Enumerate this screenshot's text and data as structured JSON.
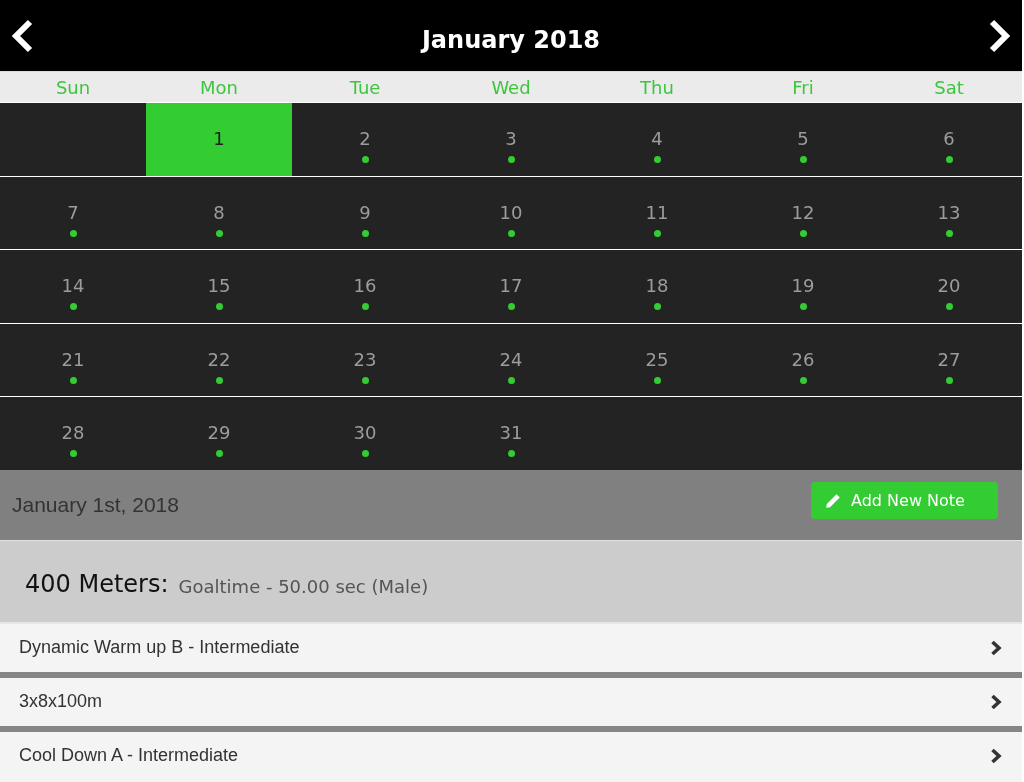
{
  "header": {
    "title": "January 2018"
  },
  "weekdays": [
    "Sun",
    "Mon",
    "Tue",
    "Wed",
    "Thu",
    "Fri",
    "Sat"
  ],
  "weeks": [
    {
      "days": [
        {
          "kind": "empty"
        },
        {
          "kind": "day",
          "label": "1",
          "selected": true,
          "has_event": false
        },
        {
          "kind": "day",
          "label": "2",
          "selected": false,
          "has_event": true
        },
        {
          "kind": "day",
          "label": "3",
          "selected": false,
          "has_event": true
        },
        {
          "kind": "day",
          "label": "4",
          "selected": false,
          "has_event": true
        },
        {
          "kind": "day",
          "label": "5",
          "selected": false,
          "has_event": true
        },
        {
          "kind": "day",
          "label": "6",
          "selected": false,
          "has_event": true
        }
      ]
    },
    {
      "days": [
        {
          "kind": "day",
          "label": "7",
          "selected": false,
          "has_event": true
        },
        {
          "kind": "day",
          "label": "8",
          "selected": false,
          "has_event": true
        },
        {
          "kind": "day",
          "label": "9",
          "selected": false,
          "has_event": true
        },
        {
          "kind": "day",
          "label": "10",
          "selected": false,
          "has_event": true
        },
        {
          "kind": "day",
          "label": "11",
          "selected": false,
          "has_event": true
        },
        {
          "kind": "day",
          "label": "12",
          "selected": false,
          "has_event": true
        },
        {
          "kind": "day",
          "label": "13",
          "selected": false,
          "has_event": true
        }
      ]
    },
    {
      "days": [
        {
          "kind": "day",
          "label": "14",
          "selected": false,
          "has_event": true
        },
        {
          "kind": "day",
          "label": "15",
          "selected": false,
          "has_event": true
        },
        {
          "kind": "day",
          "label": "16",
          "selected": false,
          "has_event": true
        },
        {
          "kind": "day",
          "label": "17",
          "selected": false,
          "has_event": true
        },
        {
          "kind": "day",
          "label": "18",
          "selected": false,
          "has_event": true
        },
        {
          "kind": "day",
          "label": "19",
          "selected": false,
          "has_event": true
        },
        {
          "kind": "day",
          "label": "20",
          "selected": false,
          "has_event": true
        }
      ]
    },
    {
      "days": [
        {
          "kind": "day",
          "label": "21",
          "selected": false,
          "has_event": true
        },
        {
          "kind": "day",
          "label": "22",
          "selected": false,
          "has_event": true
        },
        {
          "kind": "day",
          "label": "23",
          "selected": false,
          "has_event": true
        },
        {
          "kind": "day",
          "label": "24",
          "selected": false,
          "has_event": true
        },
        {
          "kind": "day",
          "label": "25",
          "selected": false,
          "has_event": true
        },
        {
          "kind": "day",
          "label": "26",
          "selected": false,
          "has_event": true
        },
        {
          "kind": "day",
          "label": "27",
          "selected": false,
          "has_event": true
        }
      ]
    },
    {
      "days": [
        {
          "kind": "day",
          "label": "28",
          "selected": false,
          "has_event": true
        },
        {
          "kind": "day",
          "label": "29",
          "selected": false,
          "has_event": true
        },
        {
          "kind": "day",
          "label": "30",
          "selected": false,
          "has_event": true
        },
        {
          "kind": "day",
          "label": "31",
          "selected": false,
          "has_event": true
        },
        {
          "kind": "empty"
        },
        {
          "kind": "empty"
        },
        {
          "kind": "empty"
        }
      ]
    }
  ],
  "day_panel": {
    "date": "January 1st, 2018",
    "add_button": "Add New Note"
  },
  "goal": {
    "event": "400 Meters:",
    "detail": "Goaltime - 50.00 sec (Male)"
  },
  "workouts": [
    {
      "label": "Dynamic Warm up B - Intermediate"
    },
    {
      "label": "3x8x100m"
    },
    {
      "label": "Cool Down A - Intermediate"
    }
  ]
}
